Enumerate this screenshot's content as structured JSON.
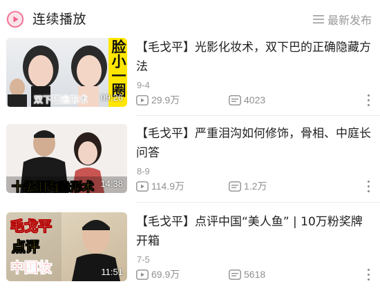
{
  "header": {
    "title": "连续播放",
    "sort_label": "最新发布",
    "accent_color": "#f0628a"
  },
  "videos": [
    {
      "title": "【毛戈平】光影化妆术，双下巴的正确隐藏方法",
      "date": "9-4",
      "views": "29.9万",
      "danmaku": "4023",
      "duration": "09:26",
      "thumb_caption": "双下巴隐形术",
      "thumb_side_caption": "脸小一圈"
    },
    {
      "title": "【毛戈平】严重泪沟如何修饰，骨相、中庭长问答",
      "date": "8-9",
      "views": "114.9万",
      "danmaku": "1.2万",
      "duration": "14:38",
      "thumb_caption": "十级泪沟隐形术"
    },
    {
      "title": "【毛戈平】点评中国“美人鱼” | 10万粉奖牌开箱",
      "date": "7-5",
      "views": "69.9万",
      "danmaku": "5618",
      "duration": "11:51",
      "thumb_caption_line1": "毛戈平",
      "thumb_caption_line2": "点评",
      "thumb_caption_line3": "中国妆"
    }
  ]
}
